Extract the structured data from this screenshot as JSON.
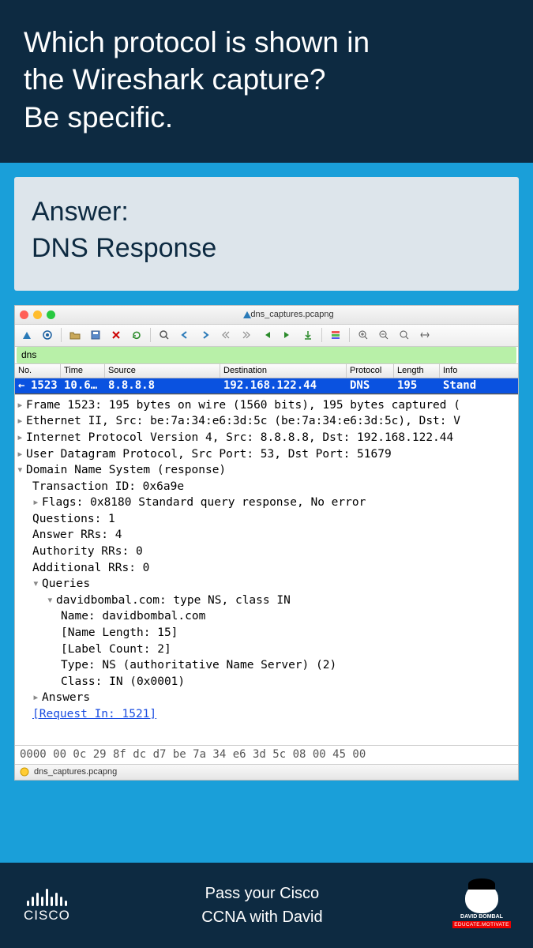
{
  "question": {
    "line1": "Which protocol is shown in",
    "line2": "the Wireshark capture?",
    "line3": "Be specific."
  },
  "answer": {
    "label": "Answer:",
    "text": "DNS Response"
  },
  "wireshark": {
    "titlebar_file": "dns_captures.pcapng",
    "filter": "dns",
    "columns": {
      "no": "No.",
      "time": "Time",
      "source": "Source",
      "destination": "Destination",
      "protocol": "Protocol",
      "length": "Length",
      "info": "Info"
    },
    "packet": {
      "no": "1523",
      "time": "10.6…",
      "source": "8.8.8.8",
      "destination": "192.168.122.44",
      "protocol": "DNS",
      "length": "195",
      "info": "Stand"
    },
    "details": [
      {
        "cls": "line",
        "tri": "▸",
        "text": "Frame 1523: 195 bytes on wire (1560 bits), 195 bytes captured ("
      },
      {
        "cls": "line",
        "tri": "▸",
        "text": "Ethernet II, Src: be:7a:34:e6:3d:5c (be:7a:34:e6:3d:5c), Dst: V"
      },
      {
        "cls": "line",
        "tri": "▸",
        "text": "Internet Protocol Version 4, Src: 8.8.8.8, Dst: 192.168.122.44"
      },
      {
        "cls": "line",
        "tri": "▸",
        "text": "User Datagram Protocol, Src Port: 53, Dst Port: 51679"
      },
      {
        "cls": "line",
        "tri": "▾",
        "text": "Domain Name System (response)"
      },
      {
        "cls": "line indent1",
        "tri": "",
        "text": "Transaction ID: 0x6a9e"
      },
      {
        "cls": "line indent1",
        "tri": "▸",
        "text": "Flags: 0x8180 Standard query response, No error"
      },
      {
        "cls": "line indent1",
        "tri": "",
        "text": "Questions: 1"
      },
      {
        "cls": "line indent1",
        "tri": "",
        "text": "Answer RRs: 4"
      },
      {
        "cls": "line indent1",
        "tri": "",
        "text": "Authority RRs: 0"
      },
      {
        "cls": "line indent1",
        "tri": "",
        "text": "Additional RRs: 0"
      },
      {
        "cls": "line indent1",
        "tri": "▾",
        "text": "Queries"
      },
      {
        "cls": "line indent2",
        "tri": "▾",
        "text": "davidbombal.com: type NS, class IN"
      },
      {
        "cls": "line indent3",
        "tri": "",
        "text": "Name: davidbombal.com"
      },
      {
        "cls": "line indent3",
        "tri": "",
        "text": "[Name Length: 15]"
      },
      {
        "cls": "line indent3",
        "tri": "",
        "text": "[Label Count: 2]"
      },
      {
        "cls": "line indent3",
        "tri": "",
        "text": "Type: NS (authoritative Name Server) (2)"
      },
      {
        "cls": "line indent3",
        "tri": "",
        "text": "Class: IN (0x0001)"
      },
      {
        "cls": "line indent1",
        "tri": "▸",
        "text": "Answers"
      },
      {
        "cls": "line indent1 link-line",
        "tri": "",
        "text": "[Request In: 1521]"
      }
    ],
    "hex": "0000   00 0c 29 8f dc d7 be 7a  34 e6 3d 5c 08 00 45 00",
    "statusbar_file": "dns_captures.pcapng"
  },
  "footer": {
    "line1": "Pass your Cisco",
    "line2": "CCNA with David",
    "cisco": "CISCO",
    "db_name": "DAVID BOMBAL",
    "db_tag": "EDUCATE.MOTIVATE"
  }
}
